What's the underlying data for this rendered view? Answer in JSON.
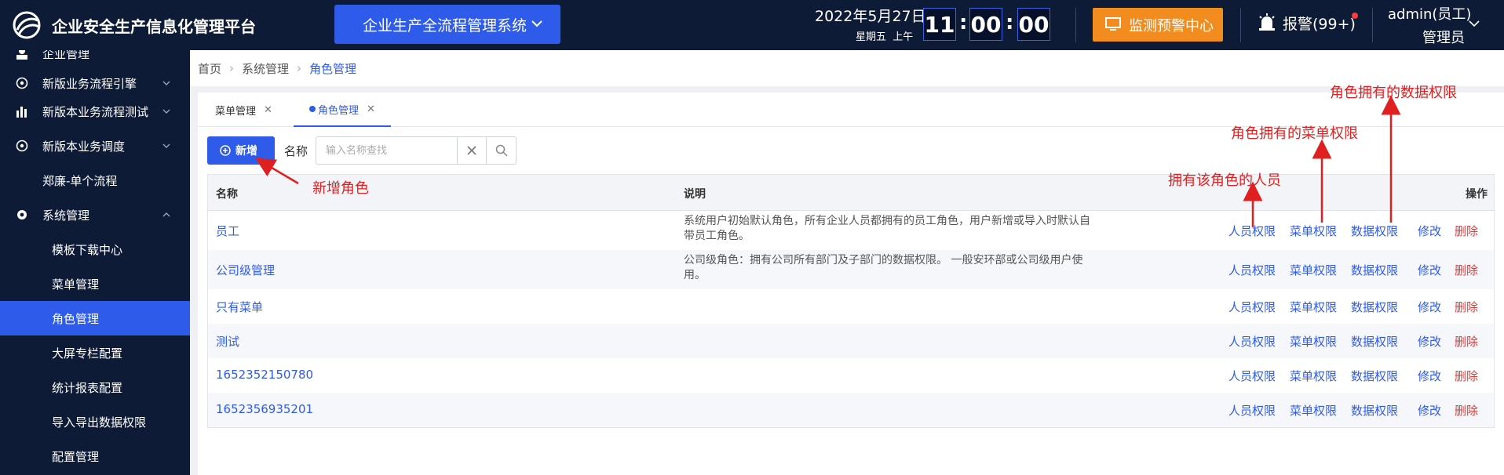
{
  "header": {
    "app_title": "企业安全生产信息化管理平台",
    "system_select": "企业生产全流程管理系统",
    "date": "2022年5月27日",
    "weekday": "星期五",
    "period": "上午",
    "clock": {
      "hh": "11",
      "mm": "00",
      "ss": "00"
    },
    "monitor_button": "监测预警中心",
    "alarm": "报警(99+)",
    "user_name": "admin(员工)",
    "user_role": "管理员"
  },
  "sidebar": {
    "items": [
      {
        "label": "企业管理",
        "icon": "user-icon"
      },
      {
        "label": "新版业务流程引擎",
        "icon": "gear-circle-icon"
      },
      {
        "label": "新版本业务流程测试",
        "icon": "bar-chart-icon"
      },
      {
        "label": "新版本业务调度",
        "icon": "gear-circle-icon"
      },
      {
        "label": "郑廉-单个流程"
      },
      {
        "label": "系统管理",
        "icon": "gear-icon"
      },
      {
        "label": "模板下载中心"
      },
      {
        "label": "菜单管理"
      },
      {
        "label": "角色管理"
      },
      {
        "label": "大屏专栏配置"
      },
      {
        "label": "统计报表配置"
      },
      {
        "label": "导入导出数据权限"
      },
      {
        "label": "配置管理"
      }
    ],
    "active": "角色管理"
  },
  "breadcrumb": [
    "首页",
    "系统管理",
    "角色管理"
  ],
  "tabs": [
    {
      "label": "菜单管理"
    },
    {
      "label": "角色管理",
      "active": true
    }
  ],
  "toolbar": {
    "add_label": "新增",
    "name_label": "名称",
    "search_placeholder": "输入名称查找"
  },
  "table": {
    "columns": [
      "名称",
      "说明",
      "操作"
    ],
    "actions": [
      "人员权限",
      "菜单权限",
      "数据权限",
      "修改",
      "删除"
    ],
    "rows": [
      {
        "name": "员工",
        "desc_lines": [
          "系统用户初始默认角色，所有企业人员都拥有的员工角色，用户新增或导入时默认自",
          "带员工角色。"
        ]
      },
      {
        "name": "公司级管理",
        "desc_lines": [
          "公司级角色：拥有公司所有部门及子部门的数据权限。 一般安环部或公司级用户使",
          "用。"
        ]
      },
      {
        "name": "只有菜单",
        "desc_lines": []
      },
      {
        "name": "测试",
        "desc_lines": []
      },
      {
        "name": "1652352150780",
        "desc_lines": []
      },
      {
        "name": "1652356935201",
        "desc_lines": []
      }
    ]
  },
  "annotations": {
    "add_role": "新增角色",
    "people": "拥有该角色的人员",
    "menu_perm": "角色拥有的菜单权限",
    "data_perm": "角色拥有的数据权限",
    "color": "#e02020"
  },
  "colors": {
    "accent": "#2f5bea",
    "header_bg": "#0e1b36",
    "warning": "#f28c1e",
    "danger": "#e03b3b"
  }
}
